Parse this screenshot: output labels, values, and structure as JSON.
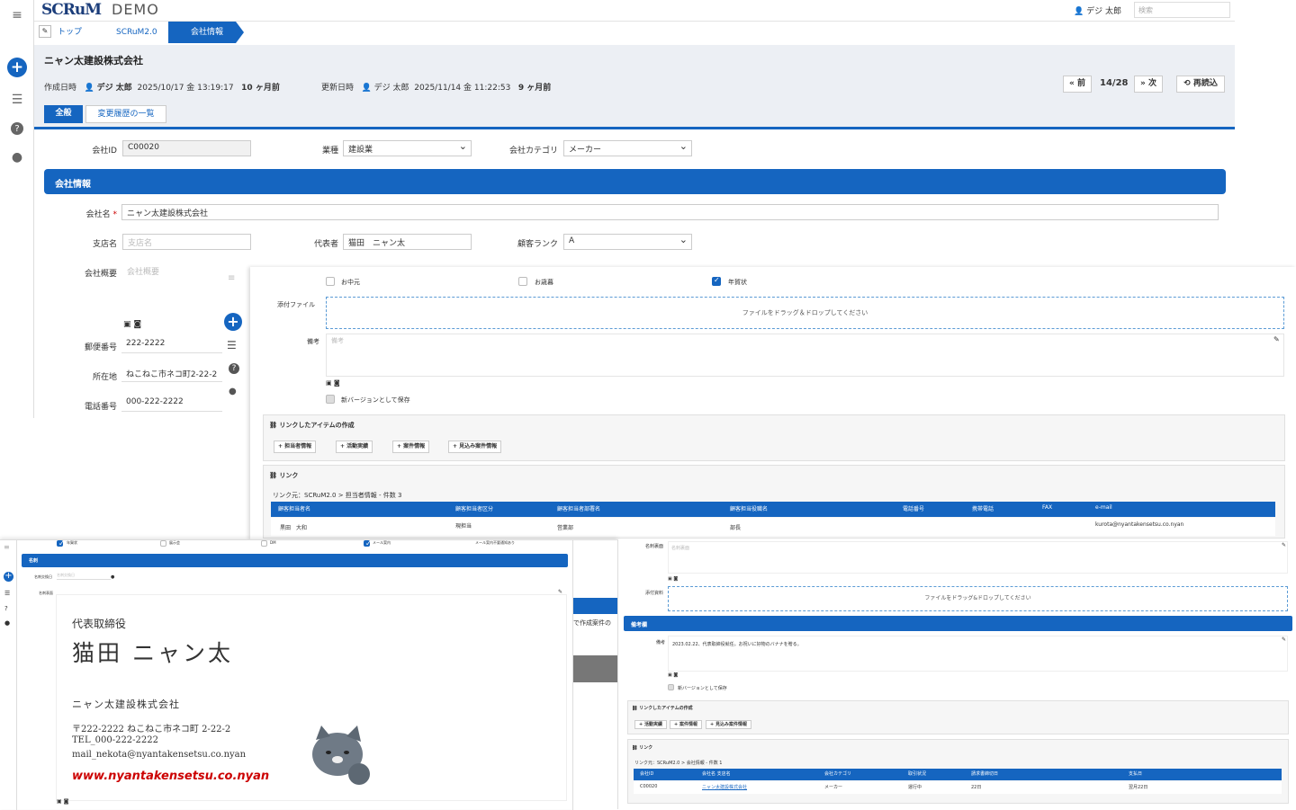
{
  "app": {
    "logo": "SCRuM",
    "demo": "DEMO",
    "user": "デジ 太郎",
    "search_placeholder": "検索"
  },
  "breadcrumbs": [
    "トップ",
    "SCRuM2.0",
    "会社情報"
  ],
  "record": {
    "title": "ニャン太建設株式会社",
    "created_label": "作成日時",
    "created_by": "デジ 太郎",
    "created_at": "2025/10/17 金 13:19:17",
    "created_ago": "10 ヶ月前",
    "updated_label": "更新日時",
    "updated_by": "デジ 太郎",
    "updated_at": "2025/11/14 金 11:22:53",
    "updated_ago": "9 ヶ月前",
    "prev": "前",
    "position": "14/28",
    "next": "次",
    "reload": "再読込"
  },
  "tabs": [
    "全般",
    "変更履歴の一覧"
  ],
  "form": {
    "company_id_label": "会社ID",
    "company_id": "C00020",
    "industry_label": "業種",
    "industry": "建設業",
    "category_label": "会社カテゴリ",
    "category": "メーカー",
    "section_title": "会社情報",
    "name_label": "会社名",
    "name": "ニャン太建設株式会社",
    "branch_label": "支店名",
    "branch_placeholder": "支店名",
    "rep_label": "代表者",
    "rep": "猫田　ニャン太",
    "rank_label": "顧客ランク",
    "rank": "A",
    "overview_label": "会社概要",
    "overview_placeholder": "会社概要",
    "zip_label": "郵便番号",
    "zip": "222-2222",
    "address_label": "所在地",
    "address": "ねこねこ市ネコ町2-22-2",
    "phone_label": "電話番号",
    "phone": "000-222-2222"
  },
  "panel2": {
    "checks": [
      "お中元",
      "お歳暮",
      "年賀状"
    ],
    "attach_label": "添付ファイル",
    "drop_text": "ファイルをドラッグ＆ドロップしてください",
    "note_label": "備考",
    "note_placeholder": "備考",
    "save_version": "新バージョンとして保存",
    "linked_title": "リンクしたアイテムの作成",
    "link_buttons": [
      "担当者情報",
      "活動実績",
      "案件情報",
      "見込み案件情報"
    ],
    "links_title": "リンク",
    "links_path": "リンク元：SCRuM2.0 > 担当者情報 - 件数 3",
    "table_headers": [
      "顧客担当者名",
      "顧客担当者区分",
      "顧客担当者部署名",
      "顧客担当役職名",
      "電話番号",
      "携帯電話",
      "FAX",
      "e-mail"
    ],
    "row": [
      "黒田　大和",
      "現担当",
      "営業部",
      "部長",
      "",
      "",
      "",
      "kurota@nyantakensetsu.co.nyan"
    ]
  },
  "panel3": {
    "checks": [
      "年賀状",
      "展示会",
      "DM",
      "メール案内",
      "メール案内不要通知あり"
    ],
    "section": "名刺",
    "card_date_label": "名刺交換日",
    "card_date_placeholder": "名刺交換日",
    "card_label": "名刺表面",
    "card": {
      "position": "代表取締役",
      "name": "猫田 ニャン太",
      "company": "ニャン太建設株式会社",
      "address": "〒222-2222 ねこねこ市ネコ町 2-22-2",
      "tel": "TEL_000-222-2222",
      "mail": "mail_nekota@nyantakensetsu.co.nyan",
      "web": "www.nyantakensetsu.co.nyan"
    },
    "behind_text": "で作成案件の"
  },
  "panel4": {
    "card_back_label": "名刺裏面",
    "card_back_placeholder": "名刺裏面",
    "attach_label": "添付資料",
    "drop_text": "ファイルをドラッグ&ドロップしてください",
    "section": "備考欄",
    "note_label": "備考",
    "note": "2023.02.22、代表取締役就任。お祝いに好物のバナナを贈る。",
    "save_version": "新バージョンとして保存",
    "linked_title": "リンクしたアイテムの作成",
    "link_buttons": [
      "活動実績",
      "案件情報",
      "見込み案件情報"
    ],
    "links_title": "リンク",
    "links_path": "リンク元：SCRuM2.0 > 会社情報 - 件数 1",
    "table_headers": [
      "会社ID",
      "会社名 支店名",
      "会社カテゴリ",
      "取引状況",
      "請求書締切日",
      "支払日"
    ],
    "row": [
      "C00020",
      "ニャン太建設株式会社",
      "メーカー",
      "運行中",
      "22日",
      "翌月22日"
    ]
  }
}
